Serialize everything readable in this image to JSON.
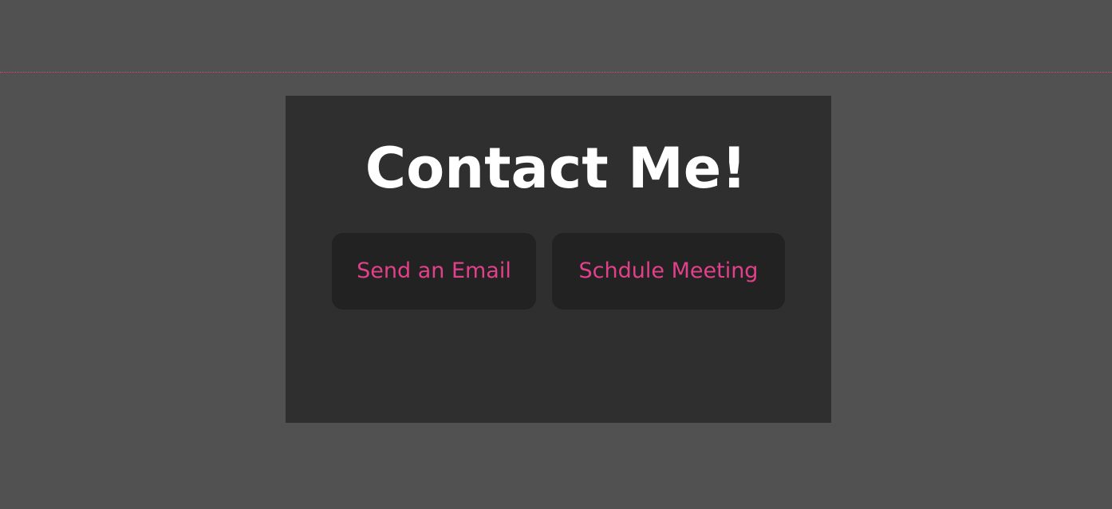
{
  "contact": {
    "title": "Contact Me!",
    "buttons": {
      "email_label": "Send an Email",
      "meeting_label": "Schdule Meeting"
    }
  },
  "colors": {
    "page_background": "#515151",
    "card_background": "#2f2f2f",
    "button_background": "#222222",
    "accent": "#e2408a",
    "title_text": "#ffffff"
  }
}
